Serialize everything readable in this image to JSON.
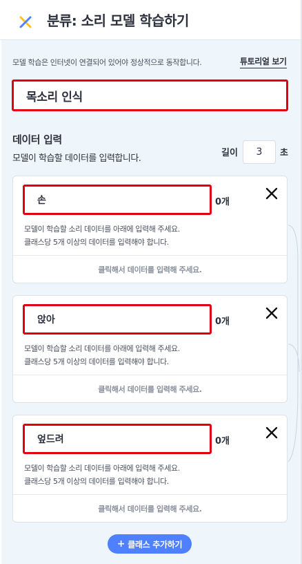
{
  "header": {
    "title": "분류: 소리 모델 학습하기",
    "logo_icon": "x-logo-icon"
  },
  "notice": "모델 학습은 인터넷이 연결되어 있어야 정상적으로 동작합니다.",
  "tutorial_link": "튜토리얼 보기",
  "model_name": "목소리 인식",
  "data_section": {
    "title": "데이터 입력",
    "description": "모델이 학습할 데이터를 입력합니다.",
    "length_label": "길이",
    "length_value": "3",
    "length_unit": "초"
  },
  "classes": [
    {
      "name": "손",
      "count": "0개",
      "desc1": "모델이 학습할 소리 데이터를 아래에 입력해 주세요.",
      "desc2": "클래스당 5개 이상의 데이터를 입력해야 합니다.",
      "input_label": "클릭해서 데이터를 입력해 주세요."
    },
    {
      "name": "앉아",
      "count": "0개",
      "desc1": "모델이 학습할 소리 데이터를 아래에 입력해 주세요.",
      "desc2": "클래스당 5개 이상의 데이터를 입력해야 합니다.",
      "input_label": "클릭해서 데이터를 입력해 주세요."
    },
    {
      "name": "엎드려",
      "count": "0개",
      "desc1": "모델이 학습할 소리 데이터를 아래에 입력해 주세요.",
      "desc2": "클래스당 5개 이상의 데이터를 입력해야 합니다.",
      "input_label": "클릭해서 데이터를 입력해 주세요."
    }
  ],
  "add_class_label": "클래스 추가하기",
  "colors": {
    "accent_blue": "#4f80ff",
    "highlight_red": "#e0000f",
    "panel_bg": "#eef6fc",
    "logo_blue": "#4f80ff",
    "logo_yellow": "#ffc21a"
  }
}
